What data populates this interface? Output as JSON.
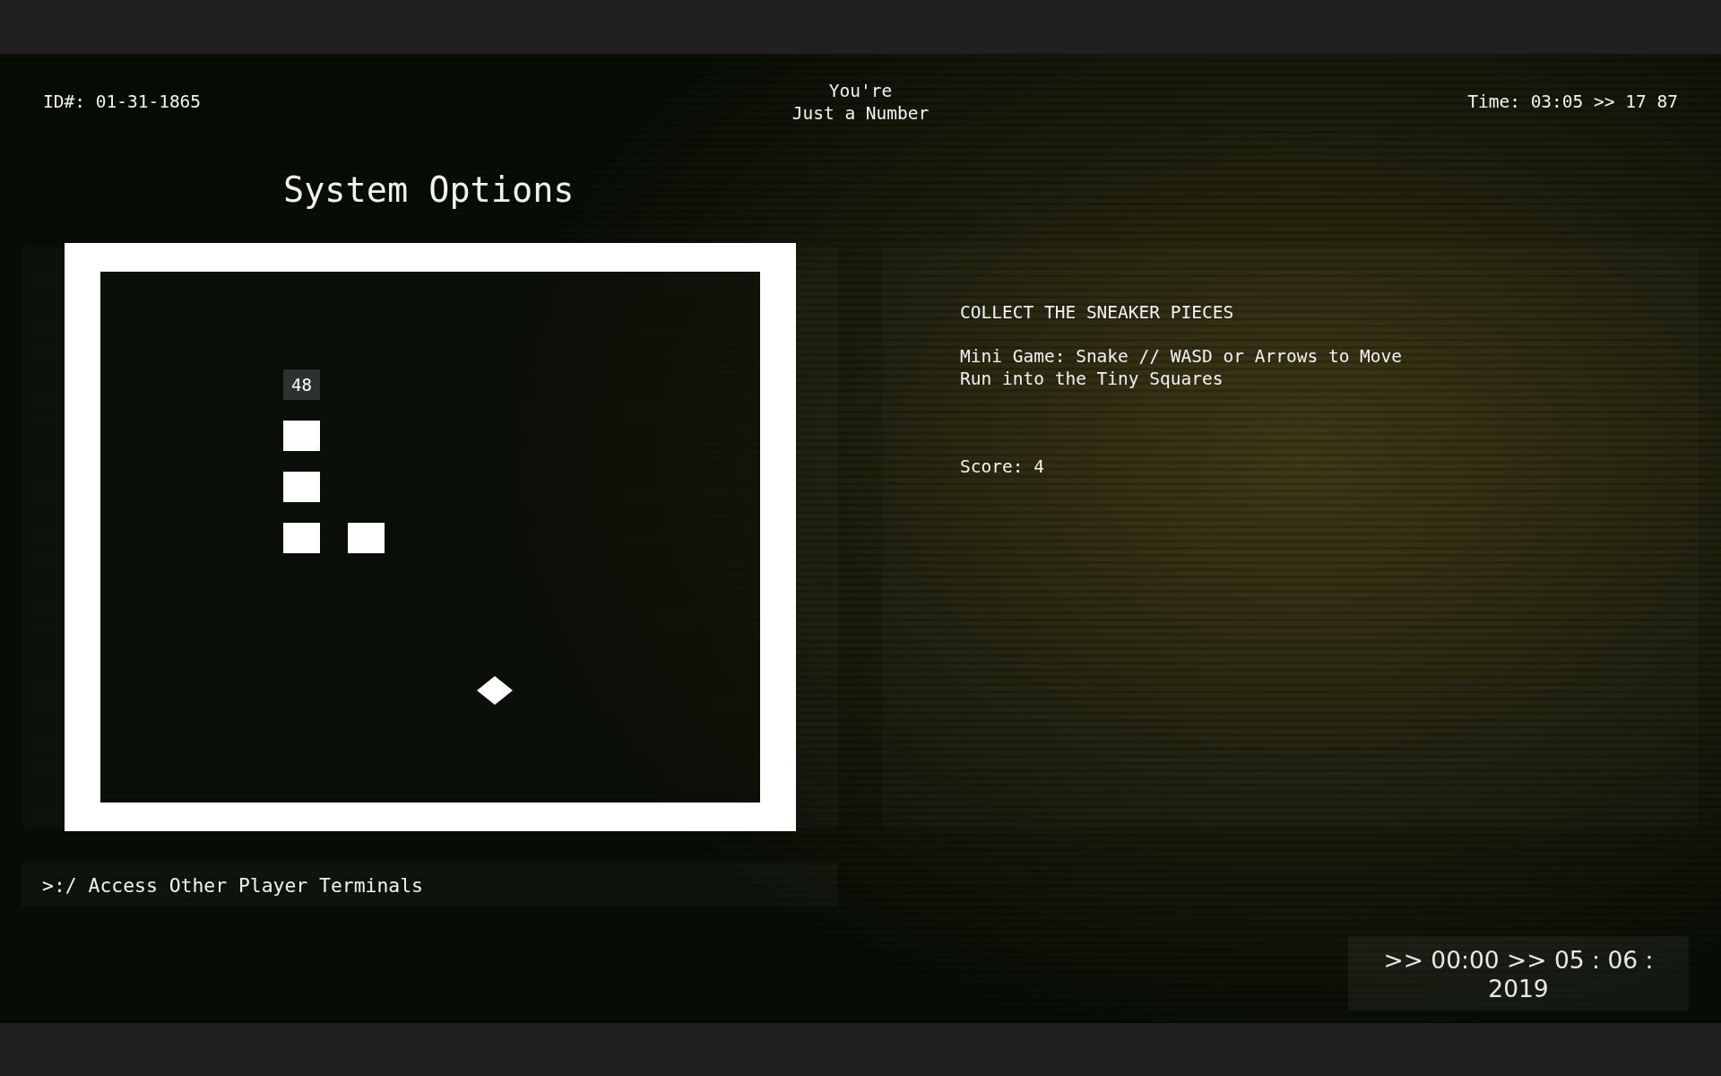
{
  "header": {
    "id": "ID#: 01-31-1865",
    "title_lines": [
      "You're",
      "Just a Number"
    ],
    "time": "Time: 03:05 >> 17 87"
  },
  "page_title": "System Options",
  "game": {
    "snake": [
      {
        "kind": "head",
        "text": "48"
      },
      {
        "kind": "body"
      },
      {
        "kind": "body"
      },
      {
        "kind": "body"
      },
      {
        "kind": "body"
      }
    ]
  },
  "info": {
    "heading": "COLLECT THE SNEAKER PIECES",
    "instructions": [
      "Mini Game: Snake // WASD or Arrows to Move",
      "Run into the Tiny Squares"
    ],
    "score": "Score: 4"
  },
  "access_link": ">:/ Access Other Player Terminals",
  "date_readout": ">> 00:00 >> 05 : 06 : 2019"
}
